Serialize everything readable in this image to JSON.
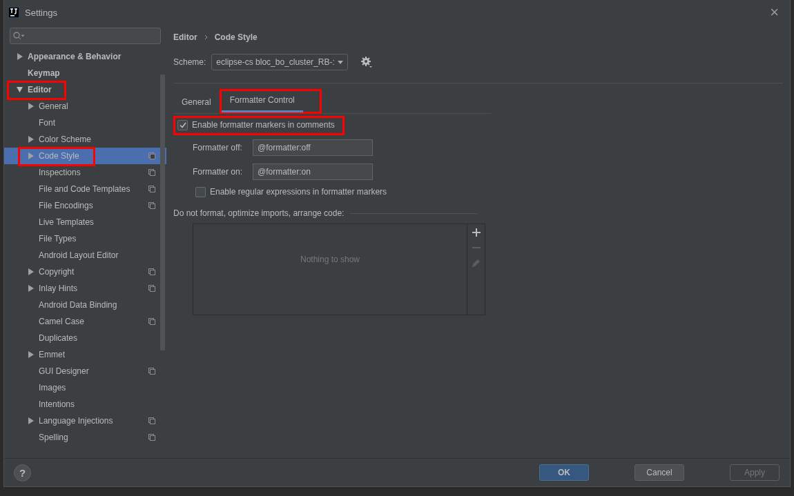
{
  "window": {
    "title": "Settings",
    "close": "×"
  },
  "sidebar": {
    "items": [
      {
        "label": "Appearance & Behavior",
        "expanded": false,
        "selected": false,
        "highlighted": false
      },
      {
        "label": "Keymap",
        "selected": false,
        "highlighted": false
      },
      {
        "label": "Editor",
        "expanded": true,
        "selected": false,
        "highlighted": true,
        "children": [
          {
            "label": "General",
            "expanded": false,
            "selected": false,
            "highlighted": false,
            "project": false
          },
          {
            "label": "Font",
            "selected": false,
            "highlighted": false,
            "project": false
          },
          {
            "label": "Color Scheme",
            "expanded": false,
            "selected": false,
            "highlighted": false,
            "project": false
          },
          {
            "label": "Code Style",
            "expanded": false,
            "selected": true,
            "highlighted": true,
            "project": true
          },
          {
            "label": "Inspections",
            "selected": false,
            "highlighted": false,
            "project": true
          },
          {
            "label": "File and Code Templates",
            "selected": false,
            "highlighted": false,
            "project": true
          },
          {
            "label": "File Encodings",
            "selected": false,
            "highlighted": false,
            "project": true
          },
          {
            "label": "Live Templates",
            "selected": false,
            "highlighted": false,
            "project": false
          },
          {
            "label": "File Types",
            "selected": false,
            "highlighted": false,
            "project": false
          },
          {
            "label": "Android Layout Editor",
            "selected": false,
            "highlighted": false,
            "project": false
          },
          {
            "label": "Copyright",
            "expanded": false,
            "selected": false,
            "highlighted": false,
            "project": true
          },
          {
            "label": "Inlay Hints",
            "expanded": false,
            "selected": false,
            "highlighted": false,
            "project": true
          },
          {
            "label": "Android Data Binding",
            "selected": false,
            "highlighted": false,
            "project": false
          },
          {
            "label": "Camel Case",
            "selected": false,
            "highlighted": false,
            "project": true
          },
          {
            "label": "Duplicates",
            "selected": false,
            "highlighted": false,
            "project": false
          },
          {
            "label": "Emmet",
            "expanded": false,
            "selected": false,
            "highlighted": false,
            "project": false
          },
          {
            "label": "GUI Designer",
            "selected": false,
            "highlighted": false,
            "project": true
          },
          {
            "label": "Images",
            "selected": false,
            "highlighted": false,
            "project": false
          },
          {
            "label": "Intentions",
            "selected": false,
            "highlighted": false,
            "project": false
          },
          {
            "label": "Language Injections",
            "expanded": false,
            "selected": false,
            "highlighted": false,
            "project": true
          },
          {
            "label": "Spelling",
            "selected": false,
            "highlighted": false,
            "project": true
          }
        ]
      }
    ]
  },
  "breadcrumb": [
    "Editor",
    "Code Style"
  ],
  "scheme": {
    "label": "Scheme:",
    "value": "eclipse-cs bloc_bo_cluster_RB-:"
  },
  "tabs": [
    {
      "label": "General",
      "selected": false,
      "highlighted": false
    },
    {
      "label": "Formatter Control",
      "selected": true,
      "highlighted": true
    }
  ],
  "enable_markers": {
    "label": "Enable formatter markers in comments",
    "checked": true,
    "highlighted": true
  },
  "fields": [
    {
      "label": "Formatter off:",
      "value": "@formatter:off"
    },
    {
      "label": "Formatter on:",
      "value": "@formatter:on"
    }
  ],
  "enable_regex": {
    "label": "Enable regular expressions in formatter markers",
    "checked": false,
    "highlighted": false
  },
  "exclusions": {
    "title": "Do not format, optimize imports, arrange code:",
    "empty_text": "Nothing to show"
  },
  "help": "?",
  "buttons": [
    {
      "label": "OK",
      "kind": "primary"
    },
    {
      "label": "Cancel",
      "kind": "normal"
    },
    {
      "label": "Apply",
      "kind": "disabled"
    }
  ]
}
